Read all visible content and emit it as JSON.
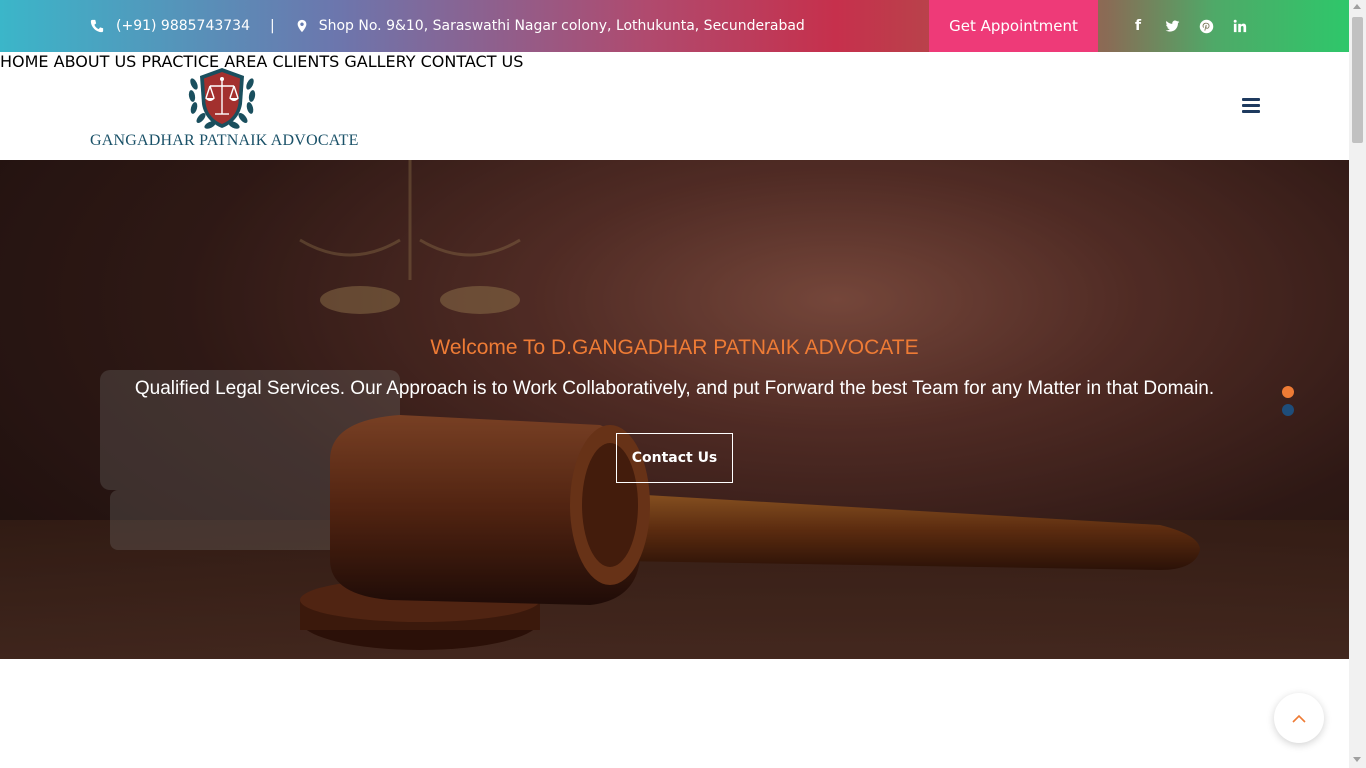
{
  "topbar": {
    "phone": "(+91) 9885743734",
    "separator": "|",
    "address": "Shop No. 9&10, Saraswathi Nagar colony, Lothukunta, Secunderabad",
    "appointment_label": "Get Appointment",
    "social": [
      {
        "icon": "facebook-icon",
        "glyph": "f"
      },
      {
        "icon": "twitter-icon",
        "glyph": "t"
      },
      {
        "icon": "pinterest-icon",
        "glyph": "p"
      },
      {
        "icon": "linkedin-icon",
        "glyph": "in"
      }
    ]
  },
  "header": {
    "logo_text": "GANGADHAR PATNAIK ADVOCATE",
    "nav": [
      "HOME",
      "ABOUT US",
      "PRACTICE AREA",
      "CLIENTS",
      "GALLERY",
      "CONTACT US"
    ],
    "menu_icon": "hamburger-icon"
  },
  "hero": {
    "welcome": "Welcome To D.GANGADHAR PATNAIK ADVOCATE",
    "tagline": "Qualified Legal Services. Our Approach is to Work Collaboratively, and put Forward the best Team for any Matter in that Domain.",
    "cta_label": "Contact Us",
    "slides_total": 2,
    "active_slide": 1
  },
  "colors": {
    "accent_orange": "#ee7b35",
    "appointment_pink": "#ee3a78",
    "logo_blue": "#1a5168"
  }
}
